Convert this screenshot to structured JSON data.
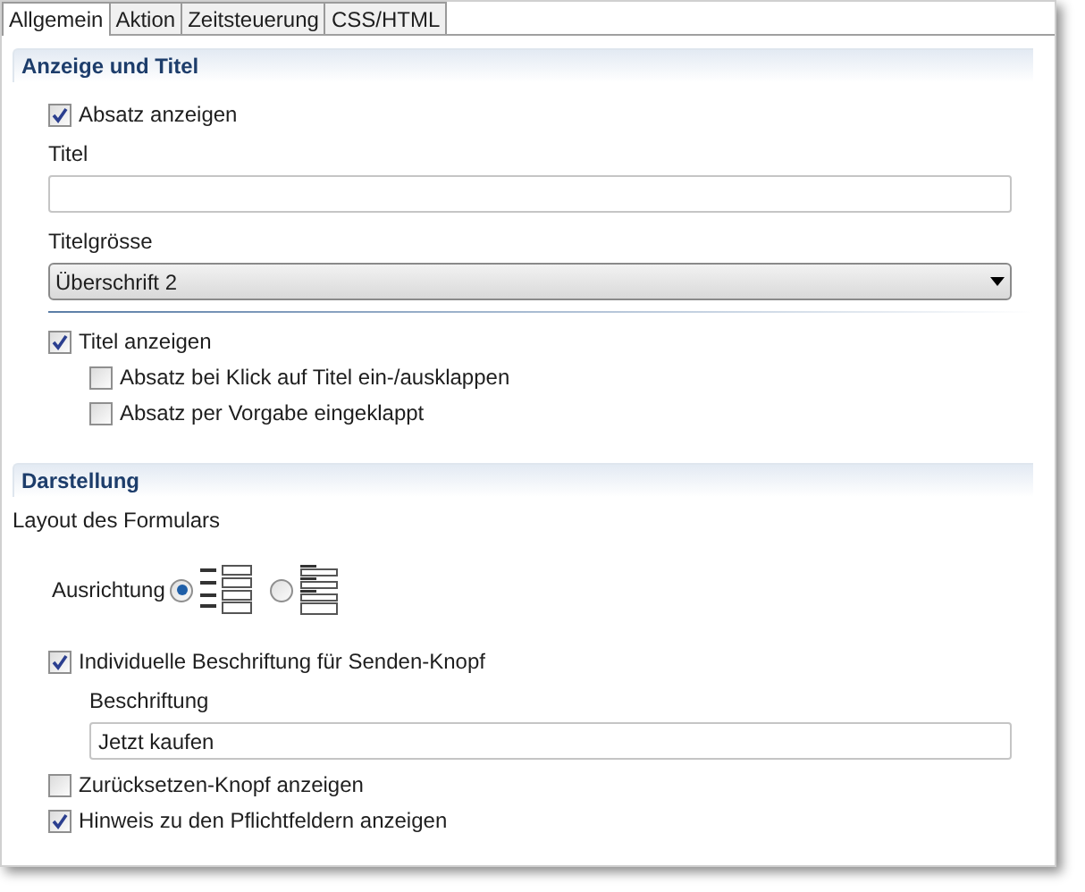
{
  "tabs": [
    {
      "label": "Allgemein",
      "selected": true
    },
    {
      "label": "Aktion",
      "selected": false
    },
    {
      "label": "Zeitsteuerung",
      "selected": false
    },
    {
      "label": "CSS/HTML",
      "selected": false
    }
  ],
  "sections": [
    {
      "title": "Anzeige und Titel",
      "items": [
        {
          "kind": "checkbox",
          "label": "Absatz anzeigen",
          "checked": true
        },
        {
          "kind": "label",
          "text": "Titel"
        },
        {
          "kind": "text_field",
          "value": ""
        },
        {
          "kind": "label",
          "text": "Titelgrösse"
        },
        {
          "kind": "select",
          "value": "Überschrift 2"
        },
        {
          "kind": "separator"
        },
        {
          "kind": "checkbox",
          "label": "Titel anzeigen",
          "checked": true,
          "children": [
            {
              "kind": "checkbox",
              "label": "Absatz bei Klick auf Titel ein-/ausklappen",
              "checked": false
            },
            {
              "kind": "checkbox",
              "label": "Absatz per Vorgabe eingeklappt",
              "checked": false
            }
          ]
        }
      ]
    },
    {
      "title": "Darstellung",
      "items": [
        {
          "kind": "caption",
          "text": "Layout des Formulars"
        },
        {
          "kind": "radio_group",
          "label": "Ausrichtung",
          "options": [
            {
              "kind": "side",
              "selected": true
            },
            {
              "kind": "stacked",
              "selected": false
            }
          ]
        },
        {
          "kind": "checkbox",
          "label": "Individuelle Beschriftung für Senden-Knopf",
          "checked": true,
          "children": [
            {
              "kind": "label",
              "text": "Beschriftung"
            },
            {
              "kind": "text_field",
              "value": "Jetzt kaufen"
            }
          ]
        },
        {
          "kind": "checkbox",
          "label": "Zurücksetzen-Knopf anzeigen",
          "checked": false
        },
        {
          "kind": "checkbox",
          "label": "Hinweis zu den Pflichtfeldern anzeigen",
          "checked": true
        }
      ]
    }
  ]
}
